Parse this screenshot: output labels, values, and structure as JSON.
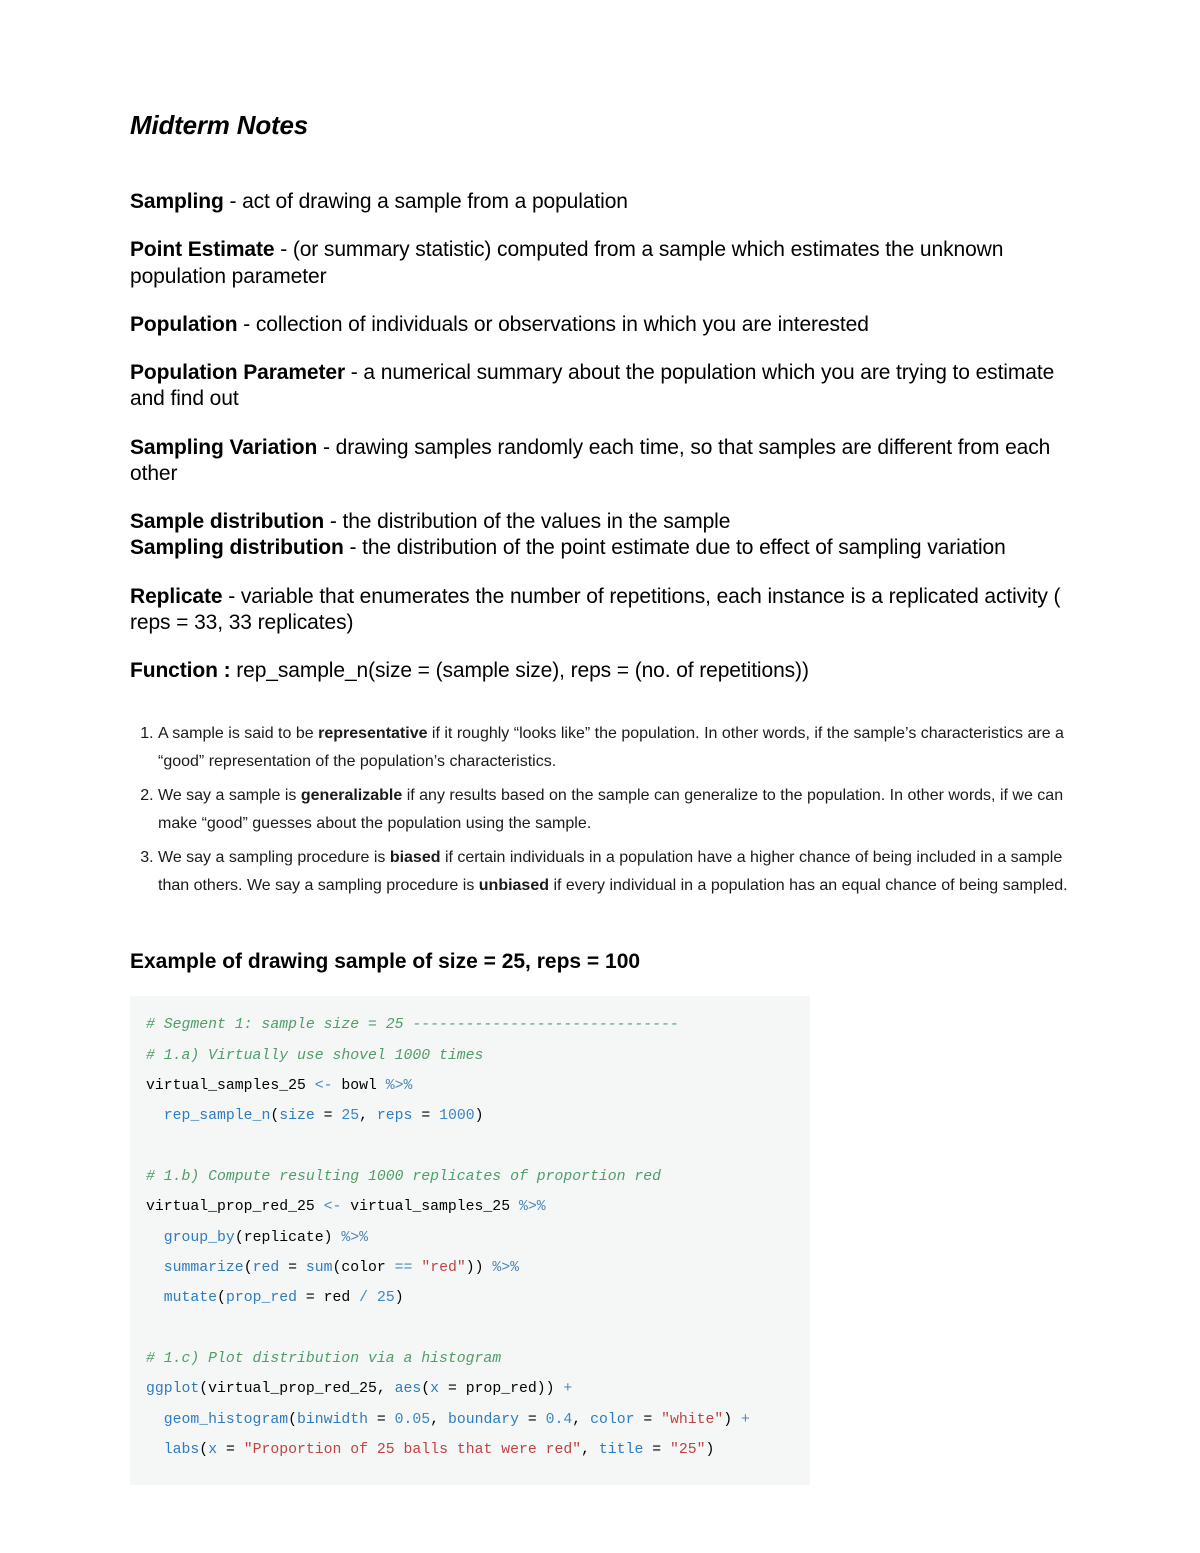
{
  "title": "Midterm Notes",
  "definitions": {
    "sampling": {
      "term": "Sampling",
      "text": " - act of drawing a sample from a population"
    },
    "point_estimate": {
      "term": "Point Estimate",
      "text": " - (or summary statistic) computed from a sample which estimates the unknown population parameter"
    },
    "population": {
      "term": "Population",
      "text": " - collection of individuals or observations in which you are interested"
    },
    "population_parameter": {
      "term": "Population Parameter",
      "text": " - a numerical summary about the population which you are trying to estimate and find out"
    },
    "sampling_variation": {
      "term": "Sampling Variation",
      "text": " - drawing samples randomly each time, so that samples are different from each other"
    },
    "sample_distribution": {
      "term": "Sample distribution",
      "text": " - the distribution of the values in the sample"
    },
    "sampling_distribution": {
      "term": "Sampling distribution",
      "text": " - the distribution of the point estimate due to effect of sampling variation"
    },
    "replicate": {
      "term": "Replicate",
      "text": " - variable that enumerates the number of repetitions, each instance is a replicated activity ( reps = 33, 33 replicates)"
    },
    "function": {
      "term": "Function :",
      "text": " rep_sample_n(size = (sample size), reps = (no. of repetitions))"
    }
  },
  "notes": {
    "1": {
      "pre": "A sample is said to be ",
      "b": "representative",
      "post": " if it roughly “looks like” the population. In other words, if the sample’s characteristics are a “good” representation of the population’s characteristics."
    },
    "2": {
      "pre": "We say a sample is ",
      "b": "generalizable",
      "post": " if any results based on the sample can generalize to the population. In other words, if we can make “good” guesses about the population using the sample."
    },
    "3": {
      "pre": "We say a sampling procedure is ",
      "b1": "biased",
      "mid": " if certain individuals in a population have a higher chance of being included in a sample than others. We say a sampling procedure is ",
      "b2": "unbiased",
      "post": " if every individual in a population has an equal chance of being sampled."
    }
  },
  "example_heading": "Example of drawing sample of size = 25, reps = 100",
  "code": {
    "c1": "# Segment 1: sample size = 25 ------------------------------",
    "c2": "# 1.a) Virtually use shovel 1000 times",
    "l3_a": "virtual_samples_25 ",
    "l3_b": "<-",
    "l3_c": " bowl ",
    "l3_d": "%>%",
    "l4_a": "  ",
    "l4_b": "rep_sample_n",
    "l4_c": "(",
    "l4_d": "size",
    "l4_e": " = ",
    "l4_f": "25",
    "l4_g": ", ",
    "l4_h": "reps",
    "l4_i": " = ",
    "l4_j": "1000",
    "l4_k": ")",
    "c5": "# 1.b) Compute resulting 1000 replicates of proportion red",
    "l6_a": "virtual_prop_red_25 ",
    "l6_b": "<-",
    "l6_c": " virtual_samples_25 ",
    "l6_d": "%>%",
    "l7_a": "  ",
    "l7_b": "group_by",
    "l7_c": "(replicate) ",
    "l7_d": "%>%",
    "l8_a": "  ",
    "l8_b": "summarize",
    "l8_c": "(",
    "l8_d": "red",
    "l8_e": " = ",
    "l8_f": "sum",
    "l8_g": "(color ",
    "l8_h": "==",
    "l8_i": " ",
    "l8_j": "\"red\"",
    "l8_k": ")) ",
    "l8_l": "%>%",
    "l9_a": "  ",
    "l9_b": "mutate",
    "l9_c": "(",
    "l9_d": "prop_red",
    "l9_e": " = red ",
    "l9_f": "/",
    "l9_g": " ",
    "l9_h": "25",
    "l9_i": ")",
    "c10": "# 1.c) Plot distribution via a histogram",
    "l11_a": "ggplot",
    "l11_b": "(virtual_prop_red_25, ",
    "l11_c": "aes",
    "l11_d": "(",
    "l11_e": "x",
    "l11_f": " = prop_red)) ",
    "l11_g": "+",
    "l12_a": "  ",
    "l12_b": "geom_histogram",
    "l12_c": "(",
    "l12_d": "binwidth",
    "l12_e": " = ",
    "l12_f": "0.05",
    "l12_g": ", ",
    "l12_h": "boundary",
    "l12_i": " = ",
    "l12_j": "0.4",
    "l12_k": ", ",
    "l12_l": "color",
    "l12_m": " = ",
    "l12_n": "\"white\"",
    "l12_o": ") ",
    "l12_p": "+",
    "l13_a": "  ",
    "l13_b": "labs",
    "l13_c": "(",
    "l13_d": "x",
    "l13_e": " = ",
    "l13_f": "\"Proportion of 25 balls that were red\"",
    "l13_g": ", ",
    "l13_h": "title",
    "l13_i": " = ",
    "l13_j": "\"25\"",
    "l13_k": ")"
  }
}
